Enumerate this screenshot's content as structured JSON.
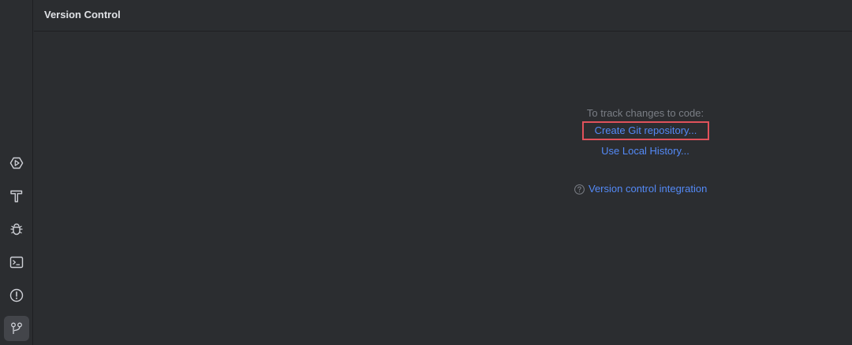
{
  "panel": {
    "title": "Version Control"
  },
  "toolbar": {
    "items": [
      {
        "icon": "run-icon",
        "active": false
      },
      {
        "icon": "build-hammer-icon",
        "active": false
      },
      {
        "icon": "debug-bug-icon",
        "active": false
      },
      {
        "icon": "terminal-icon",
        "active": false
      },
      {
        "icon": "problems-icon",
        "active": false
      },
      {
        "icon": "version-control-icon",
        "active": true
      }
    ]
  },
  "empty_state": {
    "hint": "To track changes to code:",
    "create_git_label": "Create Git repository...",
    "local_history_label": "Use Local History...",
    "help_label": "Version control integration",
    "help_icon": "question-circle-icon"
  },
  "colors": {
    "background": "#2b2d30",
    "link": "#548af7",
    "hint": "#7a7e85",
    "highlight_border": "#e0525b",
    "icon": "#ced0d6"
  }
}
